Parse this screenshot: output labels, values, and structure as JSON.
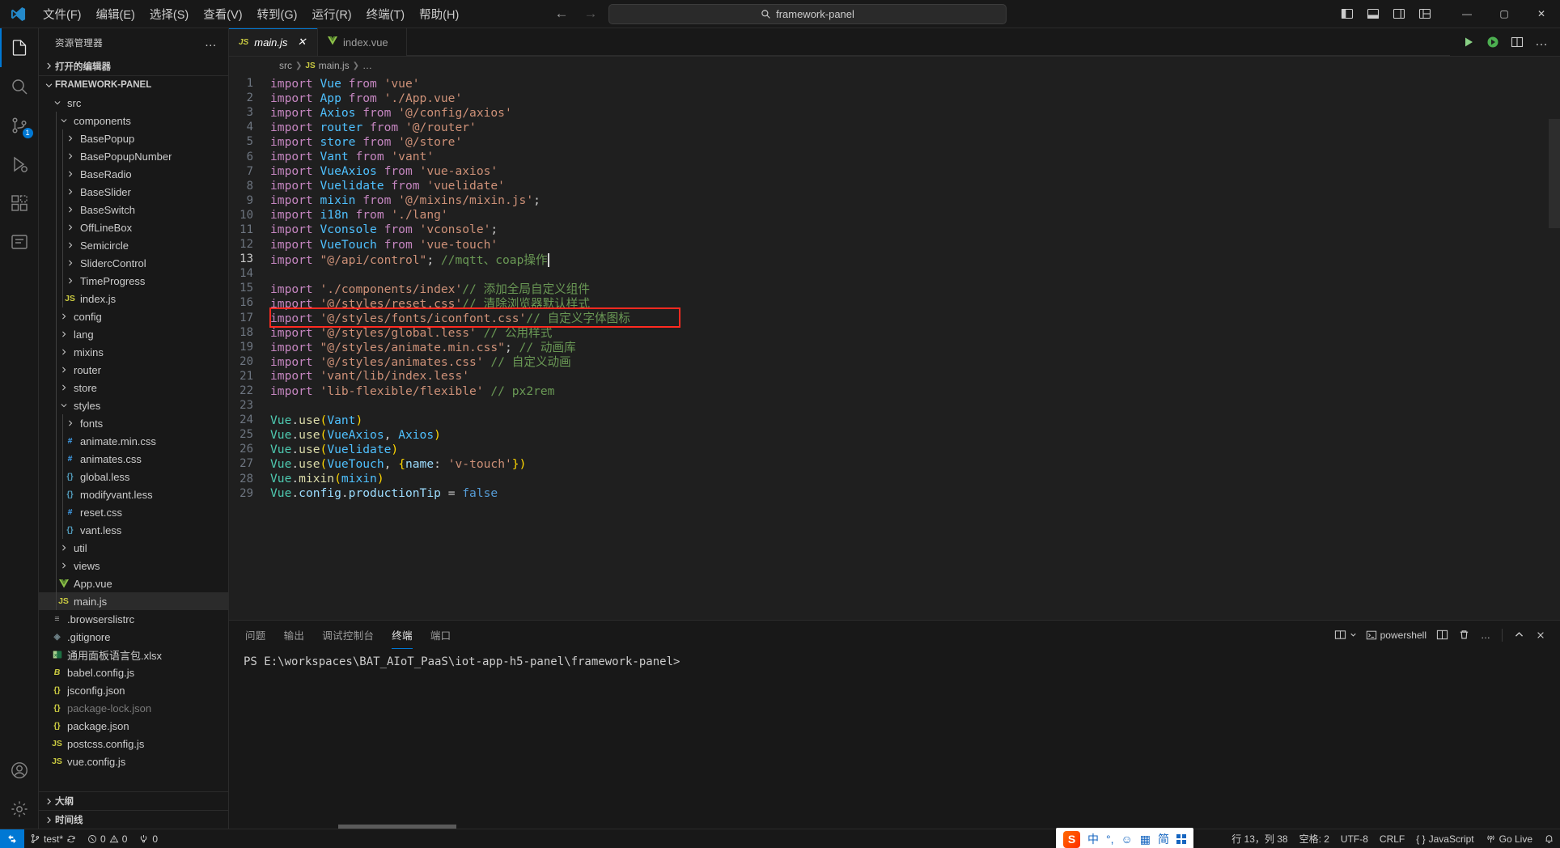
{
  "titlebar": {
    "menus": [
      "文件(F)",
      "编辑(E)",
      "选择(S)",
      "查看(V)",
      "转到(G)",
      "运行(R)",
      "终端(T)",
      "帮助(H)"
    ],
    "back_arrow": "←",
    "forward_arrow": "→",
    "command_center": "framework-panel",
    "search_icon": "search-icon",
    "layout_icons": [
      "toggle-primary-sidebar",
      "toggle-panel",
      "toggle-secondary-sidebar",
      "customize-layout"
    ],
    "window_buttons": {
      "minimize": "—",
      "maximize": "▢",
      "close": "✕"
    }
  },
  "activitybar": {
    "items": [
      {
        "name": "explorer",
        "badge": ""
      },
      {
        "name": "search",
        "badge": ""
      },
      {
        "name": "source-control",
        "badge": "1"
      },
      {
        "name": "run-and-debug",
        "badge": ""
      },
      {
        "name": "extensions",
        "badge": ""
      },
      {
        "name": "test-explorer",
        "badge": ""
      }
    ],
    "bottom": [
      "accounts",
      "settings"
    ]
  },
  "sidebar": {
    "title": "资源管理器",
    "more_actions": "…",
    "open_editors_label": "打开的编辑器",
    "project_label": "FRAMEWORK-PANEL",
    "outline_label": "大纲",
    "timeline_label": "时间线",
    "tree": [
      {
        "label": "src",
        "indent": 1,
        "type": "folder",
        "expanded": true
      },
      {
        "label": "components",
        "indent": 2,
        "type": "folder",
        "expanded": true
      },
      {
        "label": "BasePopup",
        "indent": 3,
        "type": "folder",
        "expanded": false
      },
      {
        "label": "BasePopupNumber",
        "indent": 3,
        "type": "folder",
        "expanded": false
      },
      {
        "label": "BaseRadio",
        "indent": 3,
        "type": "folder",
        "expanded": false
      },
      {
        "label": "BaseSlider",
        "indent": 3,
        "type": "folder",
        "expanded": false
      },
      {
        "label": "BaseSwitch",
        "indent": 3,
        "type": "folder",
        "expanded": false
      },
      {
        "label": "OffLineBox",
        "indent": 3,
        "type": "folder",
        "expanded": false
      },
      {
        "label": "Semicircle",
        "indent": 3,
        "type": "folder",
        "expanded": false
      },
      {
        "label": "SlidercControl",
        "indent": 3,
        "type": "folder",
        "expanded": false
      },
      {
        "label": "TimeProgress",
        "indent": 3,
        "type": "folder",
        "expanded": false
      },
      {
        "label": "index.js",
        "indent": 3,
        "type": "js"
      },
      {
        "label": "config",
        "indent": 2,
        "type": "folder",
        "expanded": false
      },
      {
        "label": "lang",
        "indent": 2,
        "type": "folder",
        "expanded": false
      },
      {
        "label": "mixins",
        "indent": 2,
        "type": "folder",
        "expanded": false
      },
      {
        "label": "router",
        "indent": 2,
        "type": "folder",
        "expanded": false
      },
      {
        "label": "store",
        "indent": 2,
        "type": "folder",
        "expanded": false
      },
      {
        "label": "styles",
        "indent": 2,
        "type": "folder",
        "expanded": true
      },
      {
        "label": "fonts",
        "indent": 3,
        "type": "folder",
        "expanded": false
      },
      {
        "label": "animate.min.css",
        "indent": 3,
        "type": "css"
      },
      {
        "label": "animates.css",
        "indent": 3,
        "type": "css"
      },
      {
        "label": "global.less",
        "indent": 3,
        "type": "less"
      },
      {
        "label": "modifyvant.less",
        "indent": 3,
        "type": "less"
      },
      {
        "label": "reset.css",
        "indent": 3,
        "type": "css"
      },
      {
        "label": "vant.less",
        "indent": 3,
        "type": "less"
      },
      {
        "label": "util",
        "indent": 2,
        "type": "folder",
        "expanded": false
      },
      {
        "label": "views",
        "indent": 2,
        "type": "folder",
        "expanded": false
      },
      {
        "label": "App.vue",
        "indent": 2,
        "type": "vue"
      },
      {
        "label": "main.js",
        "indent": 2,
        "type": "js",
        "selected": true
      },
      {
        "label": ".browserslistrc",
        "indent": 1,
        "type": "list"
      },
      {
        "label": ".gitignore",
        "indent": 1,
        "type": "git"
      },
      {
        "label": "通用面板语言包.xlsx",
        "indent": 1,
        "type": "xlsx"
      },
      {
        "label": "babel.config.js",
        "indent": 1,
        "type": "babel"
      },
      {
        "label": "jsconfig.json",
        "indent": 1,
        "type": "json"
      },
      {
        "label": "package-lock.json",
        "indent": 1,
        "type": "json",
        "dim": true
      },
      {
        "label": "package.json",
        "indent": 1,
        "type": "json"
      },
      {
        "label": "postcss.config.js",
        "indent": 1,
        "type": "js"
      },
      {
        "label": "vue.config.js",
        "indent": 1,
        "type": "js"
      }
    ]
  },
  "editor": {
    "tabs": [
      {
        "label": "main.js",
        "icon": "JS",
        "active": true,
        "dirty": false
      },
      {
        "label": "index.vue",
        "icon": "V",
        "active": false,
        "dirty": false
      }
    ],
    "tab_close": "✕",
    "actions": [
      "run-code",
      "run-extension",
      "split-editor",
      "more-actions"
    ],
    "breadcrumb": [
      "src",
      "main.js",
      "…"
    ],
    "lines": [
      {
        "n": 1,
        "segs": [
          [
            "kw",
            "import "
          ],
          [
            "var",
            "Vue"
          ],
          [
            "kw",
            " from "
          ],
          [
            "str",
            "'vue'"
          ]
        ]
      },
      {
        "n": 2,
        "segs": [
          [
            "kw",
            "import "
          ],
          [
            "var",
            "App"
          ],
          [
            "kw",
            " from "
          ],
          [
            "str",
            "'./App.vue'"
          ]
        ]
      },
      {
        "n": 3,
        "segs": [
          [
            "kw",
            "import "
          ],
          [
            "var",
            "Axios"
          ],
          [
            "kw",
            " from "
          ],
          [
            "str",
            "'@/config/axios'"
          ]
        ]
      },
      {
        "n": 4,
        "segs": [
          [
            "kw",
            "import "
          ],
          [
            "var",
            "router"
          ],
          [
            "kw",
            " from "
          ],
          [
            "str",
            "'@/router'"
          ]
        ]
      },
      {
        "n": 5,
        "segs": [
          [
            "kw",
            "import "
          ],
          [
            "var",
            "store"
          ],
          [
            "kw",
            " from "
          ],
          [
            "str",
            "'@/store'"
          ]
        ]
      },
      {
        "n": 6,
        "segs": [
          [
            "kw",
            "import "
          ],
          [
            "var",
            "Vant"
          ],
          [
            "kw",
            " from "
          ],
          [
            "str",
            "'vant'"
          ]
        ]
      },
      {
        "n": 7,
        "segs": [
          [
            "kw",
            "import "
          ],
          [
            "var",
            "VueAxios"
          ],
          [
            "kw",
            " from "
          ],
          [
            "str",
            "'vue-axios'"
          ]
        ]
      },
      {
        "n": 8,
        "segs": [
          [
            "kw",
            "import "
          ],
          [
            "var",
            "Vuelidate"
          ],
          [
            "kw",
            " from "
          ],
          [
            "str",
            "'vuelidate'"
          ]
        ]
      },
      {
        "n": 9,
        "segs": [
          [
            "kw",
            "import "
          ],
          [
            "var",
            "mixin"
          ],
          [
            "kw",
            " from "
          ],
          [
            "str",
            "'@/mixins/mixin.js'"
          ],
          [
            "punct",
            ";"
          ]
        ]
      },
      {
        "n": 10,
        "segs": [
          [
            "kw",
            "import "
          ],
          [
            "var",
            "i18n"
          ],
          [
            "kw",
            " from "
          ],
          [
            "str",
            "'./lang'"
          ]
        ]
      },
      {
        "n": 11,
        "segs": [
          [
            "kw",
            "import "
          ],
          [
            "var",
            "Vconsole"
          ],
          [
            "kw",
            " from "
          ],
          [
            "str",
            "'vconsole'"
          ],
          [
            "punct",
            ";"
          ]
        ]
      },
      {
        "n": 12,
        "segs": [
          [
            "kw",
            "import "
          ],
          [
            "var",
            "VueTouch"
          ],
          [
            "kw",
            " from "
          ],
          [
            "str",
            "'vue-touch'"
          ]
        ]
      },
      {
        "n": 13,
        "segs": [
          [
            "kw",
            "import "
          ],
          [
            "str",
            "\"@/api/control\""
          ],
          [
            "punct",
            ";"
          ],
          [
            "com",
            " //mqtt、coap操作"
          ]
        ],
        "current": true,
        "caret": true
      },
      {
        "n": 14,
        "segs": []
      },
      {
        "n": 15,
        "segs": [
          [
            "kw",
            "import "
          ],
          [
            "str",
            "'./components/index'"
          ],
          [
            "com",
            "// 添加全局自定义组件"
          ]
        ]
      },
      {
        "n": 16,
        "segs": [
          [
            "kw",
            "import "
          ],
          [
            "str",
            "'@/styles/reset.css'"
          ],
          [
            "com",
            "// 清除浏览器默认样式"
          ]
        ]
      },
      {
        "n": 17,
        "segs": [
          [
            "kw",
            "import "
          ],
          [
            "str",
            "'@/styles/fonts/iconfont.css'"
          ],
          [
            "com",
            "// 自定义字体图标"
          ]
        ],
        "highlighted": true
      },
      {
        "n": 18,
        "segs": [
          [
            "kw",
            "import "
          ],
          [
            "str",
            "'@/styles/global.less'"
          ],
          [
            "com",
            " // 公用样式"
          ]
        ]
      },
      {
        "n": 19,
        "segs": [
          [
            "kw",
            "import "
          ],
          [
            "str",
            "\"@/styles/animate.min.css\""
          ],
          [
            "punct",
            ";"
          ],
          [
            "com",
            " // 动画库"
          ]
        ]
      },
      {
        "n": 20,
        "segs": [
          [
            "kw",
            "import "
          ],
          [
            "str",
            "'@/styles/animates.css'"
          ],
          [
            "com",
            " // 自定义动画"
          ]
        ]
      },
      {
        "n": 21,
        "segs": [
          [
            "kw",
            "import "
          ],
          [
            "str",
            "'vant/lib/index.less'"
          ]
        ]
      },
      {
        "n": 22,
        "segs": [
          [
            "kw",
            "import "
          ],
          [
            "str",
            "'lib-flexible/flexible'"
          ],
          [
            "com",
            " // px2rem"
          ]
        ]
      },
      {
        "n": 23,
        "segs": []
      },
      {
        "n": 24,
        "segs": [
          [
            "obj",
            "Vue"
          ],
          [
            "punct",
            "."
          ],
          [
            "fn",
            "use"
          ],
          [
            "paren",
            "("
          ],
          [
            "var",
            "Vant"
          ],
          [
            "paren",
            ")"
          ]
        ]
      },
      {
        "n": 25,
        "segs": [
          [
            "obj",
            "Vue"
          ],
          [
            "punct",
            "."
          ],
          [
            "fn",
            "use"
          ],
          [
            "paren",
            "("
          ],
          [
            "var",
            "VueAxios"
          ],
          [
            "punct",
            ", "
          ],
          [
            "var",
            "Axios"
          ],
          [
            "paren",
            ")"
          ]
        ]
      },
      {
        "n": 26,
        "segs": [
          [
            "obj",
            "Vue"
          ],
          [
            "punct",
            "."
          ],
          [
            "fn",
            "use"
          ],
          [
            "paren",
            "("
          ],
          [
            "var",
            "Vuelidate"
          ],
          [
            "paren",
            ")"
          ]
        ]
      },
      {
        "n": 27,
        "segs": [
          [
            "obj",
            "Vue"
          ],
          [
            "punct",
            "."
          ],
          [
            "fn",
            "use"
          ],
          [
            "paren",
            "("
          ],
          [
            "var",
            "VueTouch"
          ],
          [
            "punct",
            ", "
          ],
          [
            "paren",
            "{"
          ],
          [
            "prop",
            "name"
          ],
          [
            "punct",
            ": "
          ],
          [
            "str",
            "'v-touch'"
          ],
          [
            "paren",
            "}"
          ],
          [
            "paren",
            ")"
          ]
        ]
      },
      {
        "n": 28,
        "segs": [
          [
            "obj",
            "Vue"
          ],
          [
            "punct",
            "."
          ],
          [
            "fn",
            "mixin"
          ],
          [
            "paren",
            "("
          ],
          [
            "var",
            "mixin"
          ],
          [
            "paren",
            ")"
          ]
        ]
      },
      {
        "n": 29,
        "segs": [
          [
            "obj",
            "Vue"
          ],
          [
            "punct",
            "."
          ],
          [
            "prop",
            "config"
          ],
          [
            "punct",
            "."
          ],
          [
            "prop",
            "productionTip"
          ],
          [
            "punct",
            " = "
          ],
          [
            "bool",
            "false"
          ]
        ]
      }
    ]
  },
  "panel": {
    "tabs": [
      "问题",
      "输出",
      "调试控制台",
      "终端",
      "端口"
    ],
    "active_tab": "终端",
    "shell_label": "powershell",
    "actions": [
      "split-terminal",
      "new-terminal",
      "split",
      "kill-terminal",
      "more",
      "chevron-up",
      "close"
    ],
    "terminal_prompt": "PS E:\\workspaces\\BAT_AIoT_PaaS\\iot-app-h5-panel\\framework-panel>"
  },
  "statusbar": {
    "remote_label": "",
    "branch": "test*",
    "sync_icon": "sync-icon",
    "errors": "0",
    "warnings": "0",
    "ports": "0",
    "cursor_position": "行 13，列 38",
    "indent": "空格: 2",
    "encoding": "UTF-8",
    "eol": "CRLF",
    "language": "JavaScript",
    "golive": "Go Live",
    "bell_icon": "bell-icon",
    "ime": {
      "logo": "S",
      "mode": "中",
      "punct": "°,",
      "emoji": "☺",
      "keyboard": "▦",
      "simplified": "简",
      "grid": "apps-icon"
    }
  }
}
